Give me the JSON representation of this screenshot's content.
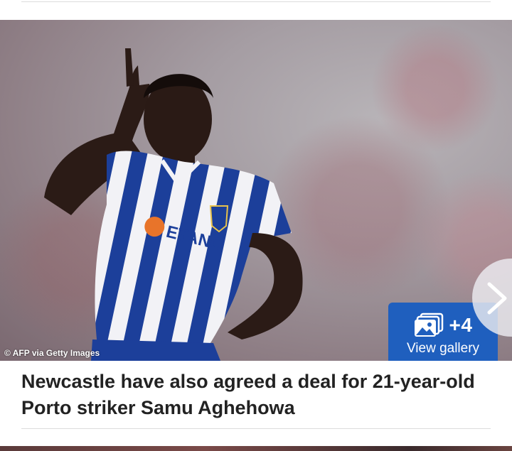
{
  "photo": {
    "credit": "© AFP via Getty Images",
    "description_alt": "Porto striker celebrating"
  },
  "gallery": {
    "count": "+4",
    "label": "View gallery",
    "icon": "gallery-icon"
  },
  "navigation": {
    "next_icon": "chevron-right-icon"
  },
  "caption": {
    "text": "Newcastle have also agreed a deal for 21-year-old Porto striker Samu Aghehowa"
  },
  "colors": {
    "gallery_button": "#1f5fbe",
    "caption_text": "#222222",
    "divider": "#dcdcdc"
  }
}
